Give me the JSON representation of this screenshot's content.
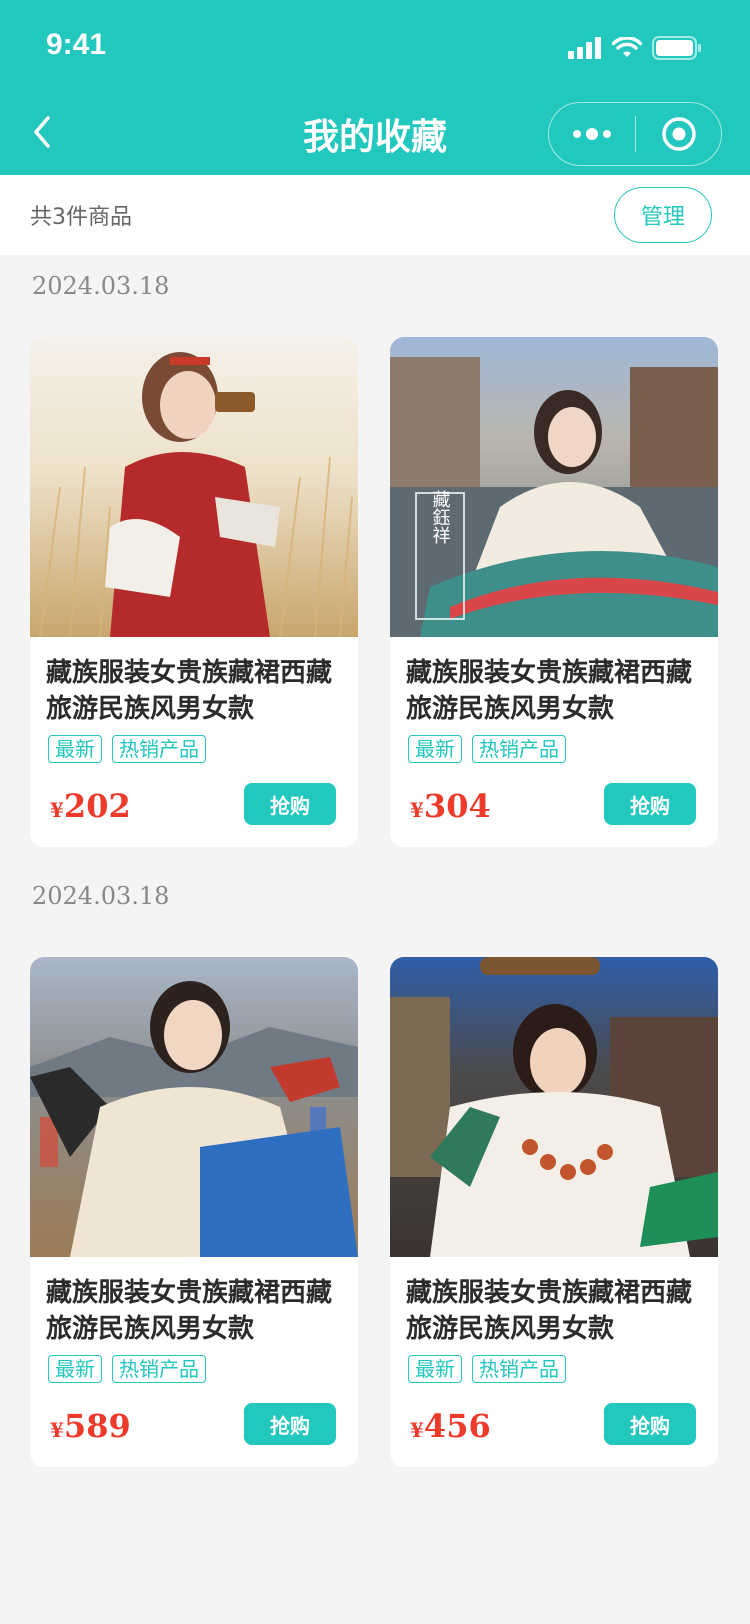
{
  "status_bar": {
    "time": "9:41"
  },
  "nav": {
    "title": "我的收藏"
  },
  "summary": {
    "count_text": "共3件商品",
    "manage_label": "管理"
  },
  "groups": [
    {
      "date": "2024.03.18",
      "items": [
        {
          "title": "藏族服装女贵族藏裙西藏旅游民族风男女款",
          "tags": [
            "最新",
            "热销产品"
          ],
          "currency": "¥",
          "price": "202",
          "buy_label": "抢购"
        },
        {
          "title": "藏族服装女贵族藏裙西藏旅游民族风男女款",
          "tags": [
            "最新",
            "热销产品"
          ],
          "currency": "¥",
          "price": "304",
          "buy_label": "抢购",
          "image_overlay": "藏鈺祥"
        }
      ]
    },
    {
      "date": "2024.03.18",
      "items": [
        {
          "title": "藏族服装女贵族藏裙西藏旅游民族风男女款",
          "tags": [
            "最新",
            "热销产品"
          ],
          "currency": "¥",
          "price": "589",
          "buy_label": "抢购"
        },
        {
          "title": "藏族服装女贵族藏裙西藏旅游民族风男女款",
          "tags": [
            "最新",
            "热销产品"
          ],
          "currency": "¥",
          "price": "456",
          "buy_label": "抢购"
        }
      ]
    }
  ],
  "colors": {
    "accent": "#22c7bd",
    "price": "#ee3a2a",
    "background": "#f4f4f4"
  }
}
